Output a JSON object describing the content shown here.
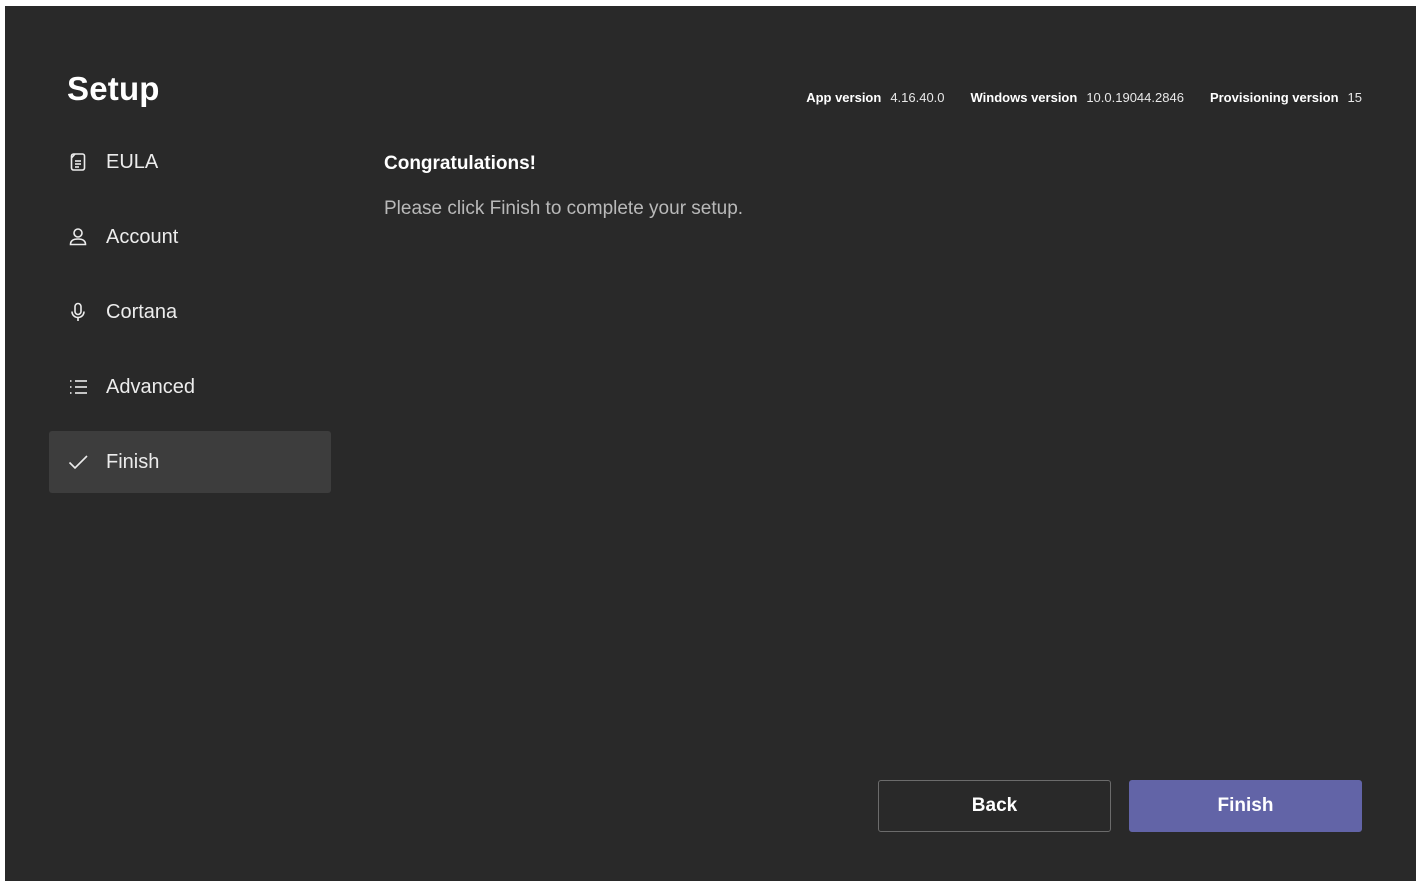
{
  "header": {
    "title": "Setup",
    "versions": [
      {
        "label": "App version",
        "value": "4.16.40.0"
      },
      {
        "label": "Windows version",
        "value": "10.0.19044.2846"
      },
      {
        "label": "Provisioning version",
        "value": "15"
      }
    ]
  },
  "sidebar": {
    "items": [
      {
        "label": "EULA",
        "icon": "document-icon",
        "active": false
      },
      {
        "label": "Account",
        "icon": "person-icon",
        "active": false
      },
      {
        "label": "Cortana",
        "icon": "microphone-icon",
        "active": false
      },
      {
        "label": "Advanced",
        "icon": "list-icon",
        "active": false
      },
      {
        "label": "Finish",
        "icon": "checkmark-icon",
        "active": true
      }
    ]
  },
  "main": {
    "heading": "Congratulations!",
    "message": "Please click Finish to complete your setup."
  },
  "footer": {
    "back_label": "Back",
    "finish_label": "Finish"
  },
  "colors": {
    "background": "#292929",
    "active_item": "#3d3d3d",
    "accent": "#6264a7"
  }
}
